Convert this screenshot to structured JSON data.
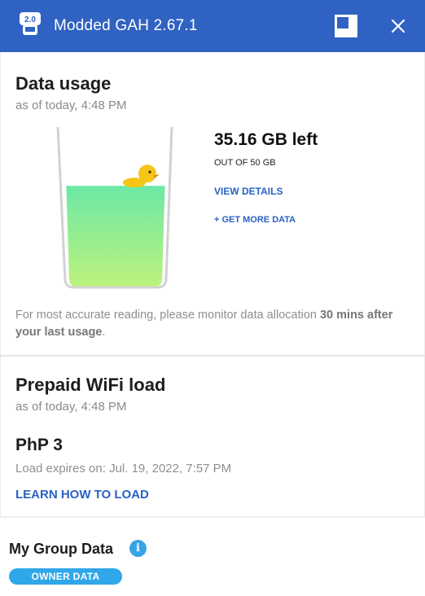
{
  "window": {
    "title": "Modded GAH 2.67.1",
    "icon_badge": "2.0",
    "accent": "#2f62c2"
  },
  "data_usage": {
    "title": "Data usage",
    "as_of": "as of today, 4:48 PM",
    "remaining": "35.16 GB left",
    "out_of": "OUT OF 50 GB",
    "view_details": "VIEW DETAILS",
    "get_more": "+ GET MORE DATA",
    "remaining_fraction": 0.7032,
    "note_prefix": "For most accurate reading, please monitor data allocation ",
    "note_bold": "30 mins after your last usage",
    "note_suffix": "."
  },
  "prepaid": {
    "title": "Prepaid WiFi load",
    "as_of": "as of today, 4:48 PM",
    "amount": "PhP 3",
    "expires": "Load expires on: Jul. 19, 2022, 7:57 PM",
    "learn_link": "LEARN HOW TO LOAD"
  },
  "group": {
    "title": "My Group Data",
    "info_icon": "i",
    "badge": "OWNER DATA",
    "badge_color": "#2fa7e8"
  }
}
